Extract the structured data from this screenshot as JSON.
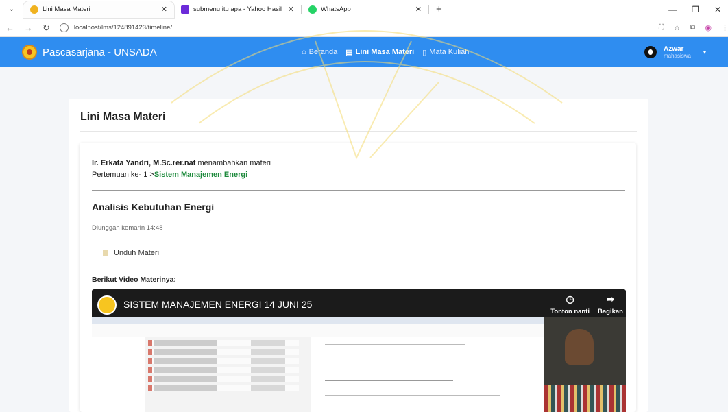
{
  "browser": {
    "tabs": [
      {
        "title": "Lini Masa Materi",
        "fav_color": "#f0b21f",
        "active": true
      },
      {
        "title": "submenu itu apa - Yahoo Hasil",
        "fav_color": "#6c2bd9",
        "active": false
      },
      {
        "title": "WhatsApp",
        "fav_color": "#25d366",
        "active": false
      }
    ],
    "url": "localhost/lms/124891423/timeline/"
  },
  "navbar": {
    "brand": "Pascasarjana - UNSADA",
    "menu": [
      {
        "label": "Beranda",
        "icon": "home-icon",
        "active": false
      },
      {
        "label": "Lini Masa Materi",
        "icon": "timeline-icon",
        "active": true
      },
      {
        "label": "Mata Kuliah",
        "icon": "book-icon",
        "active": false
      }
    ],
    "user": {
      "name": "Azwar",
      "role": "mahasiswa"
    }
  },
  "page": {
    "title": "Lini Masa Materi",
    "post": {
      "author": "Ir. Erkata Yandri, M.Sc.rer.nat",
      "action": "menambahkan materi",
      "meeting_prefix": "Pertemuan ke- 1 >",
      "course_link": "Sistem Manajemen Energi",
      "topic": "Analisis Kebutuhan Energi",
      "uploaded": "Diunggah kemarin 14:48",
      "download_label": "Unduh Materi",
      "video_intro": "Berikut Video Materinya:"
    },
    "video": {
      "title": "SISTEM MANAJEMEN ENERGI 14 JUNI 25",
      "watch_later": "Tonton nanti",
      "share": "Bagikan"
    }
  },
  "colors": {
    "navbar": "#2f8df0",
    "link_green": "#1d8a3c",
    "watermark": "#f5dc73"
  }
}
